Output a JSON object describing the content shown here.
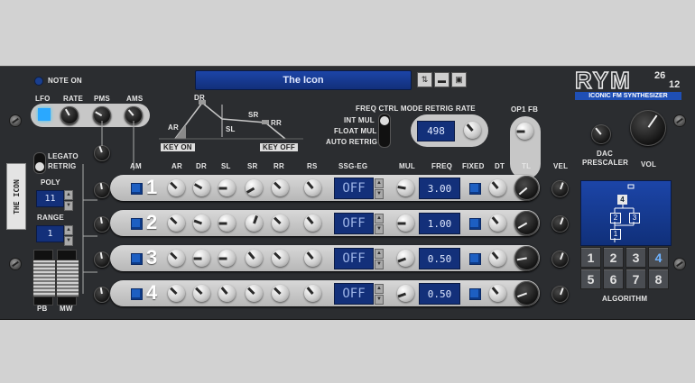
{
  "header": {
    "note_on": "NOTE ON",
    "patch_name": "The Icon",
    "logo_main": "RYM",
    "logo_num_top": "26",
    "logo_num_bottom": "12",
    "logo_sub": "ICONIC FM SYNTHESIZER",
    "brand_color": "#1f4fb5"
  },
  "side": {
    "vertical_name": "THE ICON",
    "legato": "LEGATO",
    "retrig": "RETRIG",
    "poly_label": "POLY",
    "poly_value": "11",
    "range_label": "RANGE",
    "range_value": "1",
    "pb": "PB",
    "mw": "MW"
  },
  "lfo": {
    "lfo": "LFO",
    "rate": "RATE",
    "pms": "PMS",
    "ams": "AMS"
  },
  "envelope": {
    "dr": "DR",
    "ar": "AR",
    "sl": "SL",
    "sr": "SR",
    "rr": "RR",
    "key_on": "KEY ON",
    "key_off": "KEY OFF"
  },
  "freqctrl": {
    "mode": "FREQ CTRL MODE",
    "int_mul": "INT MUL",
    "float_mul": "FLOAT MUL",
    "auto_retrig": "AUTO RETRIG",
    "retrig_rate": "RETRIG RATE",
    "retrig_value": "498"
  },
  "op1fb": "OP1 FB",
  "columns": {
    "am": "AM",
    "ar": "AR",
    "dr": "DR",
    "sl": "SL",
    "sr": "SR",
    "rr": "RR",
    "rs": "RS",
    "ssgeg": "SSG-EG",
    "mul": "MUL",
    "freq": "FREQ",
    "fixed": "FIXED",
    "dt": "DT",
    "tl": "TL",
    "vel": "VEL"
  },
  "operators": [
    {
      "num": "1",
      "ssg": "OFF",
      "freq": "3.00"
    },
    {
      "num": "2",
      "ssg": "OFF",
      "freq": "1.00"
    },
    {
      "num": "3",
      "ssg": "OFF",
      "freq": "0.50"
    },
    {
      "num": "4",
      "ssg": "OFF",
      "freq": "0.50"
    }
  ],
  "right": {
    "dac": "DAC",
    "prescaler": "PRESCALER",
    "vol": "VOL",
    "algorithm": "ALGORITHM",
    "alg_buttons": [
      "1",
      "2",
      "3",
      "4",
      "5",
      "6",
      "7",
      "8"
    ],
    "selected_alg": "4",
    "diagram_ops": [
      "4",
      "2",
      "3",
      "1"
    ]
  }
}
